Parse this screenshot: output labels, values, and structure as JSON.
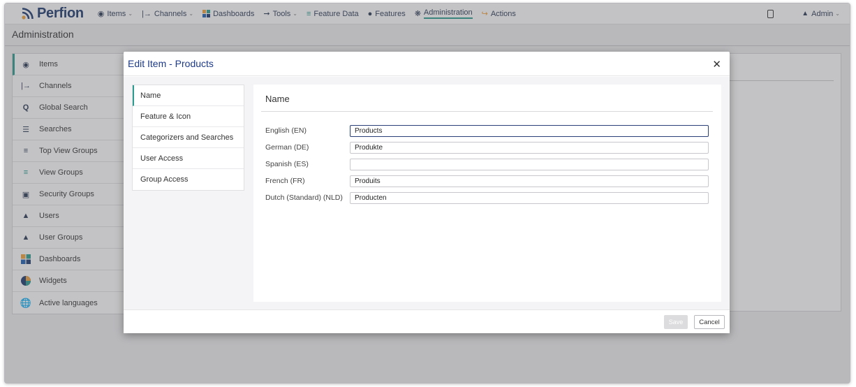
{
  "app": {
    "brand": "Perfion",
    "nav": [
      {
        "label": "Items",
        "icon": "database-icon",
        "dropdown": true
      },
      {
        "label": "Channels",
        "icon": "channel-arrow-icon",
        "dropdown": true
      },
      {
        "label": "Dashboards",
        "icon": "dashboard-grid-icon",
        "dropdown": false
      },
      {
        "label": "Tools",
        "icon": "wrench-icon",
        "dropdown": true
      },
      {
        "label": "Feature Data",
        "icon": "list-icon",
        "dropdown": false
      },
      {
        "label": "Features",
        "icon": "features-icon",
        "dropdown": false
      },
      {
        "label": "Administration",
        "icon": "gear-icon",
        "dropdown": false,
        "active": true
      },
      {
        "label": "Actions",
        "icon": "actions-icon",
        "dropdown": false
      }
    ],
    "user_label": "Admin"
  },
  "page": {
    "title": "Administration"
  },
  "sidebar": {
    "items": [
      {
        "label": "Items",
        "icon": "database-icon",
        "active": true
      },
      {
        "label": "Channels",
        "icon": "channel-arrow-icon"
      },
      {
        "label": "Global Search",
        "icon": "search-icon"
      },
      {
        "label": "Searches",
        "icon": "searches-icon"
      },
      {
        "label": "Top View Groups",
        "icon": "top-view-groups-icon"
      },
      {
        "label": "View Groups",
        "icon": "view-groups-icon"
      },
      {
        "label": "Security Groups",
        "icon": "lock-icon"
      },
      {
        "label": "Users",
        "icon": "user-icon"
      },
      {
        "label": "User Groups",
        "icon": "user-group-icon"
      },
      {
        "label": "Dashboards",
        "icon": "dashboard-grid-icon"
      },
      {
        "label": "Widgets",
        "icon": "pie-icon"
      },
      {
        "label": "Active languages",
        "icon": "globe-icon"
      }
    ]
  },
  "modal": {
    "title": "Edit Item - Products",
    "tabs": [
      {
        "label": "Name",
        "active": true
      },
      {
        "label": "Feature & Icon"
      },
      {
        "label": "Categorizers and Searches"
      },
      {
        "label": "User Access"
      },
      {
        "label": "Group Access"
      }
    ],
    "section_title": "Name",
    "fields": [
      {
        "label": "English (EN)",
        "value": "Products",
        "focused": true
      },
      {
        "label": "German (DE)",
        "value": "Produkte"
      },
      {
        "label": "Spanish (ES)",
        "value": ""
      },
      {
        "label": "French (FR)",
        "value": "Produits"
      },
      {
        "label": "Dutch (Standard) (NLD)",
        "value": "Producten"
      }
    ],
    "save_label": "Save",
    "cancel_label": "Cancel"
  },
  "colors": {
    "accent": "#2b9c8f",
    "brand": "#1d3a6e",
    "title": "#1d3a8a"
  }
}
